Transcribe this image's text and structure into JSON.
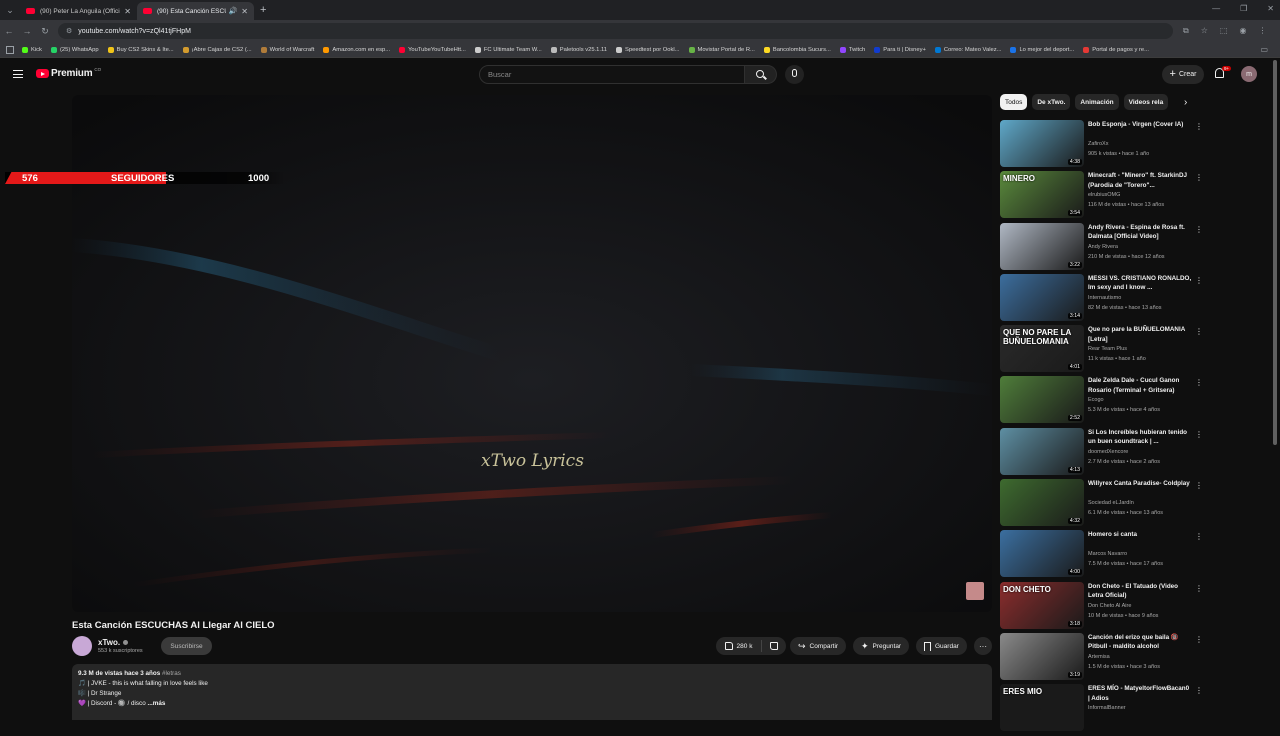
{
  "browser": {
    "tabs": [
      {
        "title": "(90) Peter La Anguila (Official V"
      },
      {
        "title": "(90) Esta Canción ESCUCHAS"
      }
    ],
    "url": "youtube.com/watch?v=zQl41tjFHpM",
    "bookmarks": [
      {
        "label": "Kick",
        "color": "#53fc18"
      },
      {
        "label": "(25) WhatsApp",
        "color": "#25d366"
      },
      {
        "label": "Buy CS2 Skins & Ite...",
        "color": "#f0c419"
      },
      {
        "label": "¡Abre Cajas de CS2 (...",
        "color": "#d39b2e"
      },
      {
        "label": "World of Warcraft",
        "color": "#b07c3a"
      },
      {
        "label": "Amazon.com en esp...",
        "color": "#ff9900"
      },
      {
        "label": "YouTubeYouTubeHtt...",
        "color": "#ff0033"
      },
      {
        "label": "FC Ultimate Team W...",
        "color": "#cccccc"
      },
      {
        "label": "Paletools v25.1.11",
        "color": "#bbbbbb"
      },
      {
        "label": "Speedtest por Ookl...",
        "color": "#cccccc"
      },
      {
        "label": "Movistar Portal de R...",
        "color": "#67b346"
      },
      {
        "label": "Bancolombia Sucurs...",
        "color": "#fdda24"
      },
      {
        "label": "Twitch",
        "color": "#9146ff"
      },
      {
        "label": "Para ti | Disney+",
        "color": "#113ccf"
      },
      {
        "label": "Correo: Mateo Valez...",
        "color": "#0078d4"
      },
      {
        "label": "Lo mejor del deport...",
        "color": "#1a73e8"
      },
      {
        "label": "Portal de pagos y re...",
        "color": "#e53935"
      }
    ]
  },
  "masthead": {
    "logo": "Premium",
    "region": "CO",
    "search_placeholder": "Buscar",
    "create_label": "Crear",
    "notifications": "9+",
    "avatar_letter": "m"
  },
  "player": {
    "overlay_text": "xTwo Lyrics",
    "follower_widget": {
      "count": "576",
      "label": "SEGUIDORES",
      "goal": "1000",
      "progress_fraction": 0.576
    }
  },
  "video": {
    "title": "Esta Canción ESCUCHAS Al Llegar Al CIELO",
    "channel": "xTwo.",
    "subscribers": "553 k suscriptores",
    "subscribe_label": "Suscribirse",
    "likes": "280 k",
    "share_label": "Compartir",
    "ask_label": "Preguntar",
    "save_label": "Guardar",
    "description": {
      "meta": "9.3 M de vistas  hace 3 años",
      "hashtag": "#letras",
      "line1": "🎵 | JVKE - this is what falling in love feels like",
      "line2": "🎼 | Dr Strange",
      "line3": "💜 | Discord - 🔘 / disco",
      "more": "...más"
    }
  },
  "sidebar": {
    "chips": [
      "Todos",
      "De xTwo.",
      "Animación",
      "Videos rela"
    ],
    "recommendations": [
      {
        "title": "Bob Esponja - Virgen (Cover IA)",
        "channel": "ZafiroXx",
        "meta": "905 k vistas • hace 1 año",
        "duration": "4:38",
        "thumb_text": "",
        "color": "#5fa8c9"
      },
      {
        "title": "Minecraft - \"Minero\" ft. StarkinDJ (Parodia de \"Torero\"...",
        "channel": "elrubiusOMG",
        "meta": "116 M de vistas • hace 13 años",
        "duration": "3:54",
        "thumb_text": "MINERO",
        "color": "#5a8a3c"
      },
      {
        "title": "Andy Rivera - Espina de Rosa ft. Dalmata [Official Video]",
        "channel": "Andy Rivera",
        "meta": "210 M de vistas • hace 12 años",
        "duration": "3:22",
        "thumb_text": "",
        "color": "#b0b8c4"
      },
      {
        "title": "MESSI VS. CRISTIANO RONALDO, Im sexy and I know ...",
        "channel": "Internautismo",
        "meta": "82 M de vistas • hace 13 años",
        "duration": "3:14",
        "thumb_text": "",
        "color": "#3c6e9e"
      },
      {
        "title": "Que no pare la BUÑUELOMANIA [Letra]",
        "channel": "Rear Team Plus",
        "meta": "11 k vistas • hace 1 año",
        "duration": "4:01",
        "thumb_text": "QUE NO PARE LA BUÑUELOMANIA",
        "color": "#2a2a2a"
      },
      {
        "title": "Dale Zelda Dale - Cucul Ganon Rosario (Terminal + Gritsera)",
        "channel": "Ecogo",
        "meta": "5.3 M de vistas • hace 4 años",
        "duration": "2:52",
        "thumb_text": "",
        "color": "#4f7d3a"
      },
      {
        "title": "Si Los Increíbles hubieran tenido un buen soundtrack | ...",
        "channel": "doomedXencore",
        "meta": "2.7 M de vistas • hace 2 años",
        "duration": "4:13",
        "thumb_text": "",
        "color": "#5e8fa3"
      },
      {
        "title": "Willyrex Canta Paradise- Coldplay",
        "channel": "Sociedad eLJardín",
        "meta": "6.1 M de vistas • hace 13 años",
        "duration": "4:32",
        "thumb_text": "",
        "color": "#3e6b2f"
      },
      {
        "title": "Homero si canta",
        "channel": "Marcos Navarro",
        "meta": "7.5 M de vistas • hace 17 años",
        "duration": "4:00",
        "thumb_text": "",
        "color": "#3b6fa0"
      },
      {
        "title": "Don Cheto - El Tatuado (Video Letra Oficial)",
        "channel": "Don Cheto Al Aire",
        "meta": "10 M de vistas • hace 9 años",
        "duration": "3:18",
        "thumb_text": "DON CHETO",
        "color": "#8c2d2d"
      },
      {
        "title": "Canción del erizo que baila 🔞 Pitbull - maldito alcohol",
        "channel": "Artemisa",
        "meta": "1.5 M de vistas • hace 3 años",
        "duration": "3:19",
        "thumb_text": "",
        "color": "#8a8a8a"
      },
      {
        "title": "ERES MÍO - MatyeltorFlowBacan0 | Adios",
        "channel": "InformalBanner",
        "meta": "",
        "duration": "",
        "thumb_text": "ERES MIO",
        "color": "#1a1a1a"
      }
    ]
  }
}
